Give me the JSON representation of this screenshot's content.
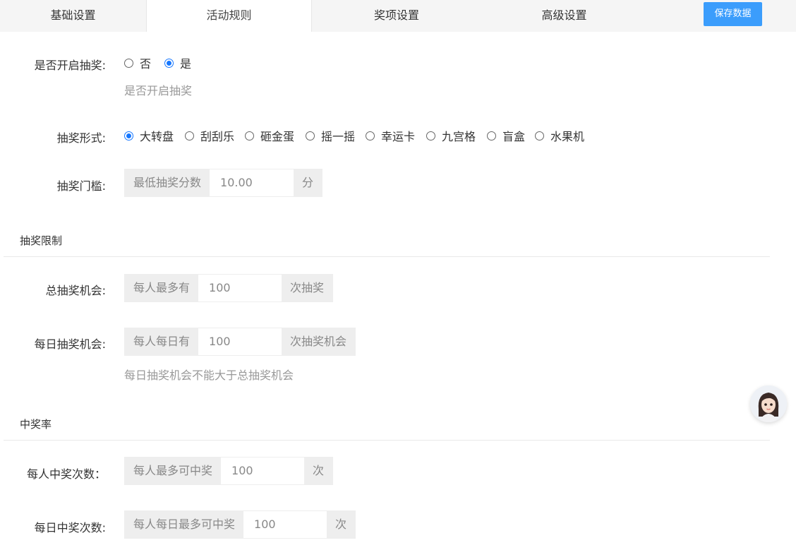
{
  "tabs": [
    {
      "label": "基础设置"
    },
    {
      "label": "活动规则"
    },
    {
      "label": "奖项设置"
    },
    {
      "label": "高级设置"
    }
  ],
  "save_button": "保存数据",
  "lottery_enabled": {
    "label": "是否开启抽奖:",
    "options": [
      "否",
      "是"
    ],
    "selected": "是",
    "hint": "是否开启抽奖"
  },
  "lottery_form": {
    "label": "抽奖形式:",
    "options": [
      "大转盘",
      "刮刮乐",
      "砸金蛋",
      "摇一摇",
      "幸运卡",
      "九宫格",
      "盲盒",
      "水果机"
    ],
    "selected": "大转盘"
  },
  "threshold": {
    "label": "抽奖门槛:",
    "prefix": "最低抽奖分数",
    "value": "10.00",
    "suffix": "分"
  },
  "limit_section": {
    "title": "抽奖限制",
    "total": {
      "label": "总抽奖机会:",
      "prefix": "每人最多有",
      "value": "100",
      "suffix": "次抽奖"
    },
    "daily": {
      "label": "每日抽奖机会:",
      "prefix": "每人每日有",
      "value": "100",
      "suffix": "次抽奖机会",
      "hint": "每日抽奖机会不能大于总抽奖机会"
    }
  },
  "rate_section": {
    "title": "中奖率",
    "per_person": {
      "label": "每人中奖次数：",
      "prefix": "每人最多可中奖",
      "value": "100",
      "suffix": "次"
    },
    "daily": {
      "label": "每日中奖次数:",
      "prefix": "每人每日最多可中奖",
      "value": "100",
      "suffix": "次"
    }
  },
  "colors": {
    "accent": "#1677ff",
    "save_button": "#3b9dfc"
  }
}
